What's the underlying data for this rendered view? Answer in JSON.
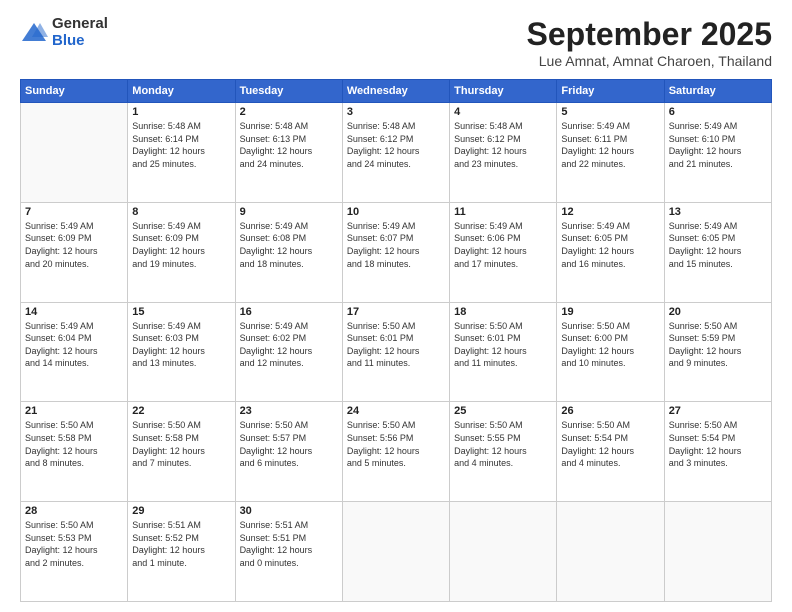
{
  "logo": {
    "general": "General",
    "blue": "Blue"
  },
  "title": "September 2025",
  "subtitle": "Lue Amnat, Amnat Charoen, Thailand",
  "days": [
    "Sunday",
    "Monday",
    "Tuesday",
    "Wednesday",
    "Thursday",
    "Friday",
    "Saturday"
  ],
  "weeks": [
    [
      {
        "date": "",
        "info": ""
      },
      {
        "date": "1",
        "info": "Sunrise: 5:48 AM\nSunset: 6:14 PM\nDaylight: 12 hours\nand 25 minutes."
      },
      {
        "date": "2",
        "info": "Sunrise: 5:48 AM\nSunset: 6:13 PM\nDaylight: 12 hours\nand 24 minutes."
      },
      {
        "date": "3",
        "info": "Sunrise: 5:48 AM\nSunset: 6:12 PM\nDaylight: 12 hours\nand 24 minutes."
      },
      {
        "date": "4",
        "info": "Sunrise: 5:48 AM\nSunset: 6:12 PM\nDaylight: 12 hours\nand 23 minutes."
      },
      {
        "date": "5",
        "info": "Sunrise: 5:49 AM\nSunset: 6:11 PM\nDaylight: 12 hours\nand 22 minutes."
      },
      {
        "date": "6",
        "info": "Sunrise: 5:49 AM\nSunset: 6:10 PM\nDaylight: 12 hours\nand 21 minutes."
      }
    ],
    [
      {
        "date": "7",
        "info": "Sunrise: 5:49 AM\nSunset: 6:09 PM\nDaylight: 12 hours\nand 20 minutes."
      },
      {
        "date": "8",
        "info": "Sunrise: 5:49 AM\nSunset: 6:09 PM\nDaylight: 12 hours\nand 19 minutes."
      },
      {
        "date": "9",
        "info": "Sunrise: 5:49 AM\nSunset: 6:08 PM\nDaylight: 12 hours\nand 18 minutes."
      },
      {
        "date": "10",
        "info": "Sunrise: 5:49 AM\nSunset: 6:07 PM\nDaylight: 12 hours\nand 18 minutes."
      },
      {
        "date": "11",
        "info": "Sunrise: 5:49 AM\nSunset: 6:06 PM\nDaylight: 12 hours\nand 17 minutes."
      },
      {
        "date": "12",
        "info": "Sunrise: 5:49 AM\nSunset: 6:05 PM\nDaylight: 12 hours\nand 16 minutes."
      },
      {
        "date": "13",
        "info": "Sunrise: 5:49 AM\nSunset: 6:05 PM\nDaylight: 12 hours\nand 15 minutes."
      }
    ],
    [
      {
        "date": "14",
        "info": "Sunrise: 5:49 AM\nSunset: 6:04 PM\nDaylight: 12 hours\nand 14 minutes."
      },
      {
        "date": "15",
        "info": "Sunrise: 5:49 AM\nSunset: 6:03 PM\nDaylight: 12 hours\nand 13 minutes."
      },
      {
        "date": "16",
        "info": "Sunrise: 5:49 AM\nSunset: 6:02 PM\nDaylight: 12 hours\nand 12 minutes."
      },
      {
        "date": "17",
        "info": "Sunrise: 5:50 AM\nSunset: 6:01 PM\nDaylight: 12 hours\nand 11 minutes."
      },
      {
        "date": "18",
        "info": "Sunrise: 5:50 AM\nSunset: 6:01 PM\nDaylight: 12 hours\nand 11 minutes."
      },
      {
        "date": "19",
        "info": "Sunrise: 5:50 AM\nSunset: 6:00 PM\nDaylight: 12 hours\nand 10 minutes."
      },
      {
        "date": "20",
        "info": "Sunrise: 5:50 AM\nSunset: 5:59 PM\nDaylight: 12 hours\nand 9 minutes."
      }
    ],
    [
      {
        "date": "21",
        "info": "Sunrise: 5:50 AM\nSunset: 5:58 PM\nDaylight: 12 hours\nand 8 minutes."
      },
      {
        "date": "22",
        "info": "Sunrise: 5:50 AM\nSunset: 5:58 PM\nDaylight: 12 hours\nand 7 minutes."
      },
      {
        "date": "23",
        "info": "Sunrise: 5:50 AM\nSunset: 5:57 PM\nDaylight: 12 hours\nand 6 minutes."
      },
      {
        "date": "24",
        "info": "Sunrise: 5:50 AM\nSunset: 5:56 PM\nDaylight: 12 hours\nand 5 minutes."
      },
      {
        "date": "25",
        "info": "Sunrise: 5:50 AM\nSunset: 5:55 PM\nDaylight: 12 hours\nand 4 minutes."
      },
      {
        "date": "26",
        "info": "Sunrise: 5:50 AM\nSunset: 5:54 PM\nDaylight: 12 hours\nand 4 minutes."
      },
      {
        "date": "27",
        "info": "Sunrise: 5:50 AM\nSunset: 5:54 PM\nDaylight: 12 hours\nand 3 minutes."
      }
    ],
    [
      {
        "date": "28",
        "info": "Sunrise: 5:50 AM\nSunset: 5:53 PM\nDaylight: 12 hours\nand 2 minutes."
      },
      {
        "date": "29",
        "info": "Sunrise: 5:51 AM\nSunset: 5:52 PM\nDaylight: 12 hours\nand 1 minute."
      },
      {
        "date": "30",
        "info": "Sunrise: 5:51 AM\nSunset: 5:51 PM\nDaylight: 12 hours\nand 0 minutes."
      },
      {
        "date": "",
        "info": ""
      },
      {
        "date": "",
        "info": ""
      },
      {
        "date": "",
        "info": ""
      },
      {
        "date": "",
        "info": ""
      }
    ]
  ]
}
